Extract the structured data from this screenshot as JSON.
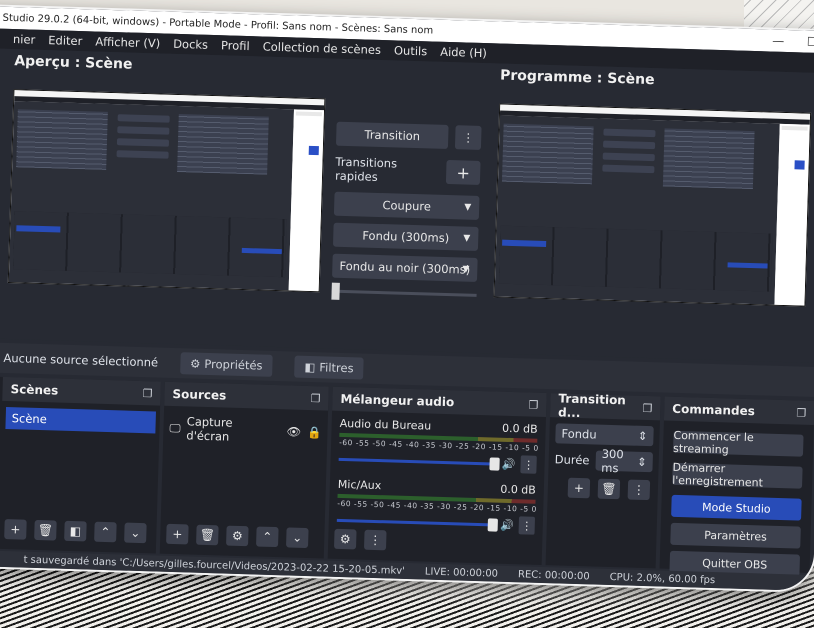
{
  "window": {
    "title": "Studio 29.0.2 (64-bit, windows) - Portable Mode - Profil: Sans nom - Scènes: Sans nom",
    "minimize": "—",
    "maximize": "☐"
  },
  "menu": [
    "nier",
    "Editer",
    "Afficher (V)",
    "Docks",
    "Profil",
    "Collection de scènes",
    "Outils",
    "Aide (H)"
  ],
  "preview": {
    "left_title": "Aperçu : Scène",
    "right_title": "Programme : Scène"
  },
  "transition_controls": {
    "transition": "Transition",
    "quick_transitions": "Transitions rapides",
    "cut": "Coupure",
    "fade": "Fondu (300ms)",
    "fade_black": "Fondu au noir (300ms)"
  },
  "source_bar": {
    "no_source": "Aucune source sélectionné",
    "properties": "Propriétés",
    "filters": "Filtres"
  },
  "docks": {
    "scenes": {
      "title": "Scènes",
      "items": [
        "Scène"
      ]
    },
    "sources": {
      "title": "Sources",
      "items": [
        "Capture d'écran"
      ]
    },
    "mixer": {
      "title": "Mélangeur audio",
      "channels": [
        {
          "name": "Audio du Bureau",
          "level": "0.0 dB",
          "volume": 1.0
        },
        {
          "name": "Mic/Aux",
          "level": "0.0 dB",
          "volume": 1.0
        }
      ],
      "scale": "-60  -55  -50  -45  -40  -35  -30  -25  -20  -15  -10  -5  0"
    },
    "transitions": {
      "title": "Transition d...",
      "selected": "Fondu",
      "duration_label": "Durée",
      "duration": "300 ms"
    },
    "controls": {
      "title": "Commandes",
      "buttons": [
        "Commencer le streaming",
        "Démarrer l'enregistrement",
        "Mode Studio",
        "Paramètres",
        "Quitter OBS"
      ]
    }
  },
  "status": {
    "saved": "t sauvegardé dans 'C:/Users/gilles.fourcel/Videos/2023-02-22 15-20-05.mkv'",
    "live": "LIVE: 00:00:00",
    "rec": "REC: 00:00:00",
    "cpu": "CPU: 2.0%, 60.00 fps"
  }
}
